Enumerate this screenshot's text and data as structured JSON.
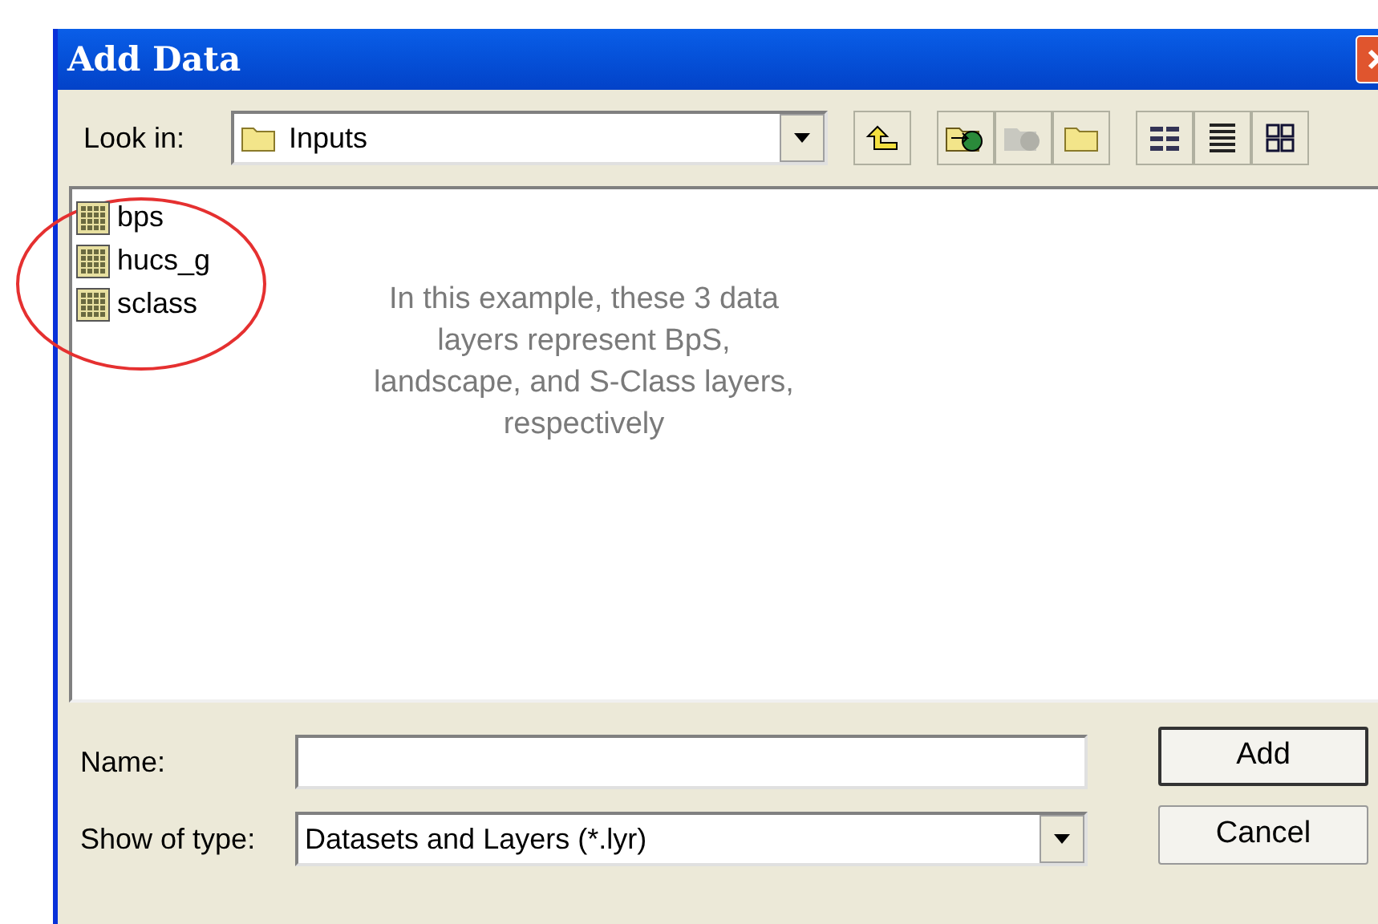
{
  "window": {
    "title": "Add Data"
  },
  "look_in": {
    "label": "Look in:",
    "value": "Inputs"
  },
  "files": [
    {
      "name": "bps"
    },
    {
      "name": "hucs_g"
    },
    {
      "name": "sclass"
    }
  ],
  "annotation": {
    "text": "In this example, these 3 data layers represent BpS, landscape, and S-Class layers, respectively"
  },
  "name_field": {
    "label": "Name:"
  },
  "type_field": {
    "label": "Show of type:",
    "value": "Datasets and Layers (*.lyr)"
  },
  "buttons": [
    {
      "label": "Add",
      "kind": "default"
    },
    {
      "label": "Cancel",
      "kind": "normal"
    }
  ]
}
